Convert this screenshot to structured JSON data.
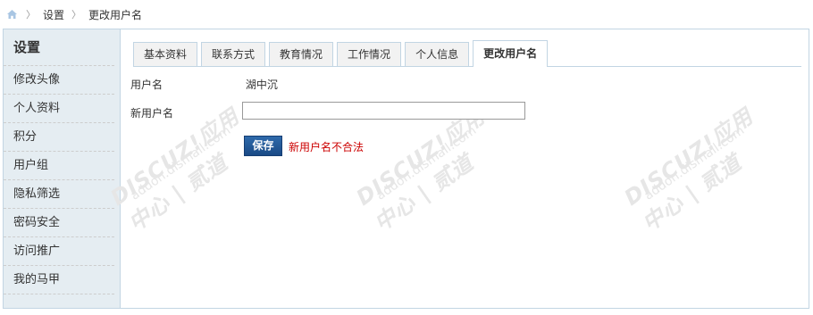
{
  "breadcrumb": {
    "home_icon": "home-icon",
    "items": [
      "设置",
      "更改用户名"
    ]
  },
  "sidebar": {
    "title": "设置",
    "items": [
      {
        "label": "修改头像"
      },
      {
        "label": "个人资料"
      },
      {
        "label": "积分"
      },
      {
        "label": "用户组"
      },
      {
        "label": "隐私筛选"
      },
      {
        "label": "密码安全"
      },
      {
        "label": "访问推广"
      },
      {
        "label": "我的马甲"
      }
    ]
  },
  "tabs": [
    {
      "label": "基本资料",
      "active": false
    },
    {
      "label": "联系方式",
      "active": false
    },
    {
      "label": "教育情况",
      "active": false
    },
    {
      "label": "工作情况",
      "active": false
    },
    {
      "label": "个人信息",
      "active": false
    },
    {
      "label": "更改用户名",
      "active": true
    }
  ],
  "form": {
    "username_label": "用户名",
    "username_value": "湖中沉",
    "new_username_label": "新用户名",
    "new_username_value": "",
    "save_label": "保存",
    "error_message": "新用户名不合法"
  },
  "watermark": {
    "brand": "DISCUZ!应用中心 | 贰道",
    "url": "addon.dismall.com"
  },
  "colors": {
    "accent": "#1a4a86",
    "error": "#cc0000",
    "sidebar_bg": "#e5edf2",
    "border": "#c2d5e3"
  }
}
